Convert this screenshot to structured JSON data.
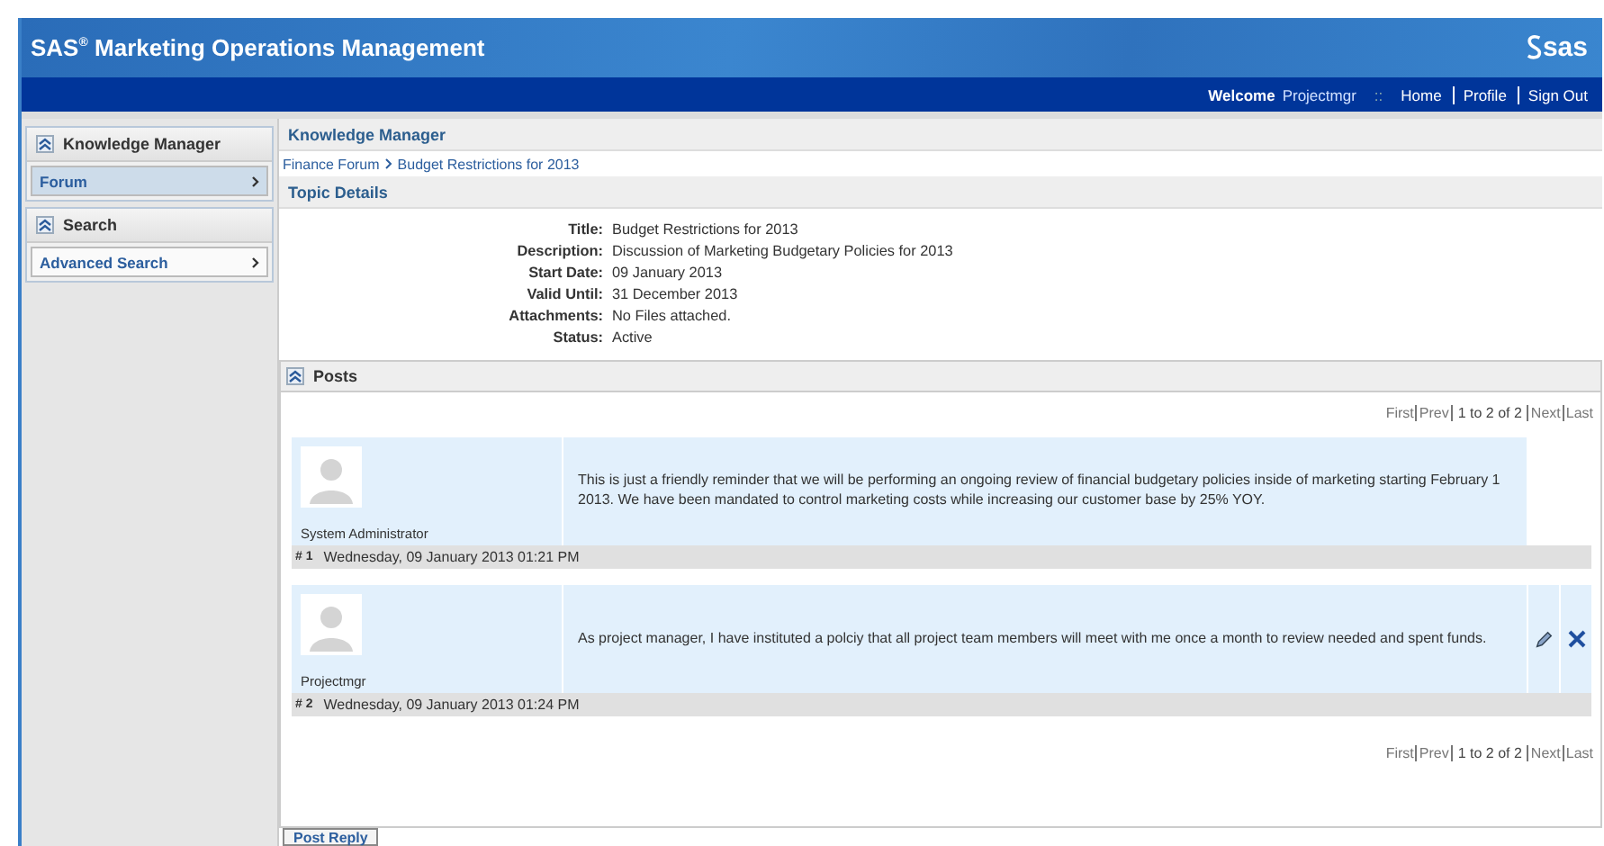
{
  "header": {
    "brand": "SAS",
    "brand_mark": "®",
    "product": "Marketing Operations Management",
    "logo": "sas"
  },
  "navbar": {
    "welcome": "Welcome",
    "user": "Projectmgr",
    "separator": "::",
    "links": [
      "Home",
      "Profile",
      "Sign Out"
    ]
  },
  "sidebar": {
    "groups": [
      {
        "title": "Knowledge Manager",
        "items": [
          {
            "label": "Forum",
            "selected": true
          }
        ]
      },
      {
        "title": "Search",
        "items": [
          {
            "label": "Advanced Search",
            "selected": false
          }
        ]
      }
    ]
  },
  "main": {
    "title": "Knowledge Manager",
    "breadcrumb": [
      "Finance Forum",
      "Budget Restrictions for 2013"
    ],
    "topic": {
      "title": "Topic Details",
      "fields": [
        {
          "label": "Title:",
          "value": "Budget Restrictions for 2013"
        },
        {
          "label": "Description:",
          "value": "Discussion of Marketing Budgetary Policies for 2013"
        },
        {
          "label": "Start Date:",
          "value": "09 January 2013"
        },
        {
          "label": "Valid Until:",
          "value": "31 December 2013"
        },
        {
          "label": "Attachments:",
          "value": "No Files attached."
        },
        {
          "label": "Status:",
          "value": "Active"
        }
      ]
    },
    "posts": {
      "title": "Posts",
      "pager_top": {
        "links_before": [
          "First",
          "Prev"
        ],
        "summary": "1 to 2 of 2",
        "links_after": [
          "Next",
          "Last"
        ]
      },
      "items": [
        {
          "author": "System Administrator",
          "body": "This is just a friendly reminder that we will be performing an ongoing review of financial budgetary policies inside of marketing starting February 1 2013. We have been mandated to control marketing costs while increasing our customer base by 25% YOY.",
          "number": "# 1",
          "date": "Wednesday, 09 January 2013 01:21 PM",
          "editable": false
        },
        {
          "author": "Projectmgr",
          "body": "As project manager, I have instituted a polciy that all project team members will meet with me once a month to review needed and spent funds.",
          "number": "# 2",
          "date": "Wednesday, 09 January 2013 01:24 PM",
          "editable": true
        }
      ],
      "pager_bottom": {
        "links_before": [
          "First",
          "Prev"
        ],
        "summary": "1 to 2 of 2",
        "links_after": [
          "Next",
          "Last"
        ]
      }
    },
    "reply_button": "Post Reply"
  }
}
